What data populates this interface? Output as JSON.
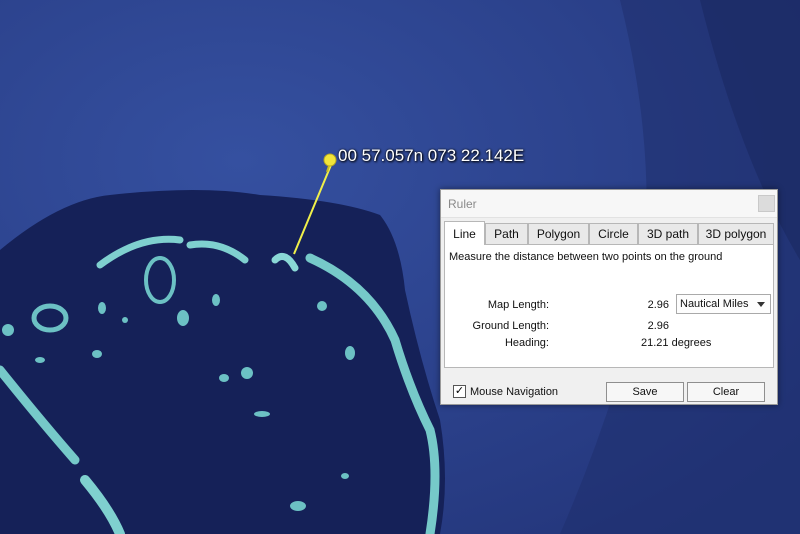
{
  "map": {
    "placemark_label": "00 57.057n 073 22.142E"
  },
  "ruler": {
    "title": "Ruler",
    "tabs": [
      {
        "label": "Line",
        "active": true
      },
      {
        "label": "Path"
      },
      {
        "label": "Polygon"
      },
      {
        "label": "Circle"
      },
      {
        "label": "3D path"
      },
      {
        "label": "3D polygon"
      }
    ],
    "description": "Measure the distance between two points on the ground",
    "map_length_label": "Map Length:",
    "map_length_value": "2.96",
    "units_selected": "Nautical Miles",
    "ground_length_label": "Ground Length:",
    "ground_length_value": "2.96",
    "heading_label": "Heading:",
    "heading_value": "21.21 degrees",
    "mouse_navigation_label": "Mouse Navigation",
    "mouse_navigation_checked": true,
    "save_label": "Save",
    "clear_label": "Clear"
  }
}
